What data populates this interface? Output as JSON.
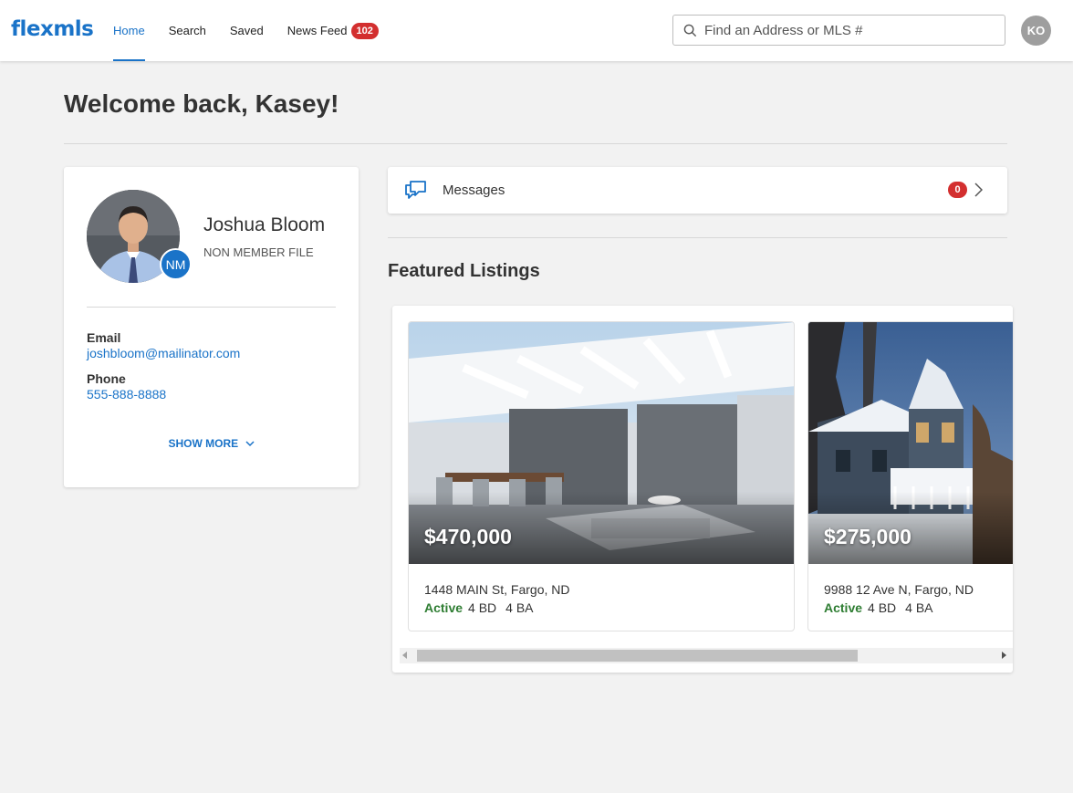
{
  "app": {
    "logo": "flexmls"
  },
  "nav": {
    "items": [
      {
        "label": "Home",
        "active": true
      },
      {
        "label": "Search"
      },
      {
        "label": "Saved"
      },
      {
        "label": "News Feed",
        "badge": "102"
      }
    ]
  },
  "search": {
    "placeholder": "Find an Address or MLS #"
  },
  "user": {
    "initials": "KO"
  },
  "welcome": "Welcome back, Kasey!",
  "contact": {
    "name": "Joshua Bloom",
    "type": "NON MEMBER FILE",
    "badge": "NM",
    "email_label": "Email",
    "email": "joshbloom@mailinator.com",
    "phone_label": "Phone",
    "phone": "555-888-8888",
    "show_more": "SHOW MORE"
  },
  "messages": {
    "label": "Messages",
    "count": "0"
  },
  "featured": {
    "title": "Featured Listings",
    "listings": [
      {
        "price": "$470,000",
        "address": "1448 MAIN St, Fargo, ND",
        "status": "Active",
        "beds": "4 BD",
        "baths": "4 BA"
      },
      {
        "price": "$275,000",
        "address": "9988 12 Ave N, Fargo, ND",
        "status": "Active",
        "beds": "4 BD",
        "baths": "4 BA"
      }
    ]
  },
  "colors": {
    "brand": "#1a73c8",
    "badge": "#d32f2f",
    "active_status": "#2e7d32"
  }
}
